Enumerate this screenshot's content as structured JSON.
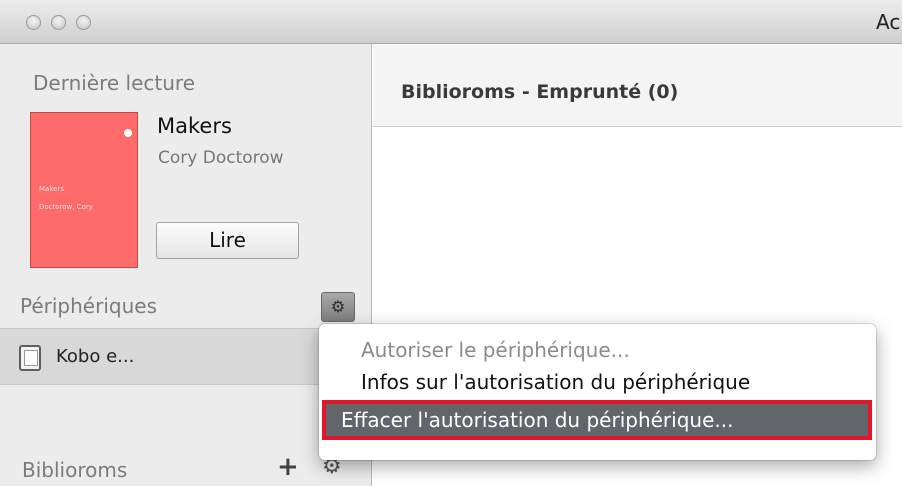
{
  "window": {
    "title": "Ac"
  },
  "sidebar": {
    "recent_heading": "Dernière lecture",
    "book": {
      "title": "Makers",
      "author": "Cory Doctorow",
      "cover_title": "Makers",
      "cover_author": "Doctorow, Cory",
      "read_button": "Lire"
    },
    "devices_heading": "Périphériques",
    "device_name": "Kobo e...",
    "bibliorooms_heading": "Biblioroms",
    "plus_symbol": "+",
    "gear_symbol": "⚙"
  },
  "main": {
    "title": "Biblioroms - Emprunté (0)"
  },
  "menu": {
    "items": [
      {
        "label": "Autoriser le périphérique...",
        "state": "disabled"
      },
      {
        "label": "Infos sur l'autorisation du périphérique",
        "state": "normal"
      },
      {
        "label": "Effacer l'autorisation du périphérique...",
        "state": "selected"
      }
    ]
  },
  "colors": {
    "cover": "#ff6b6b",
    "highlight_border": "#e0162b",
    "selected_item": "#62656a"
  }
}
